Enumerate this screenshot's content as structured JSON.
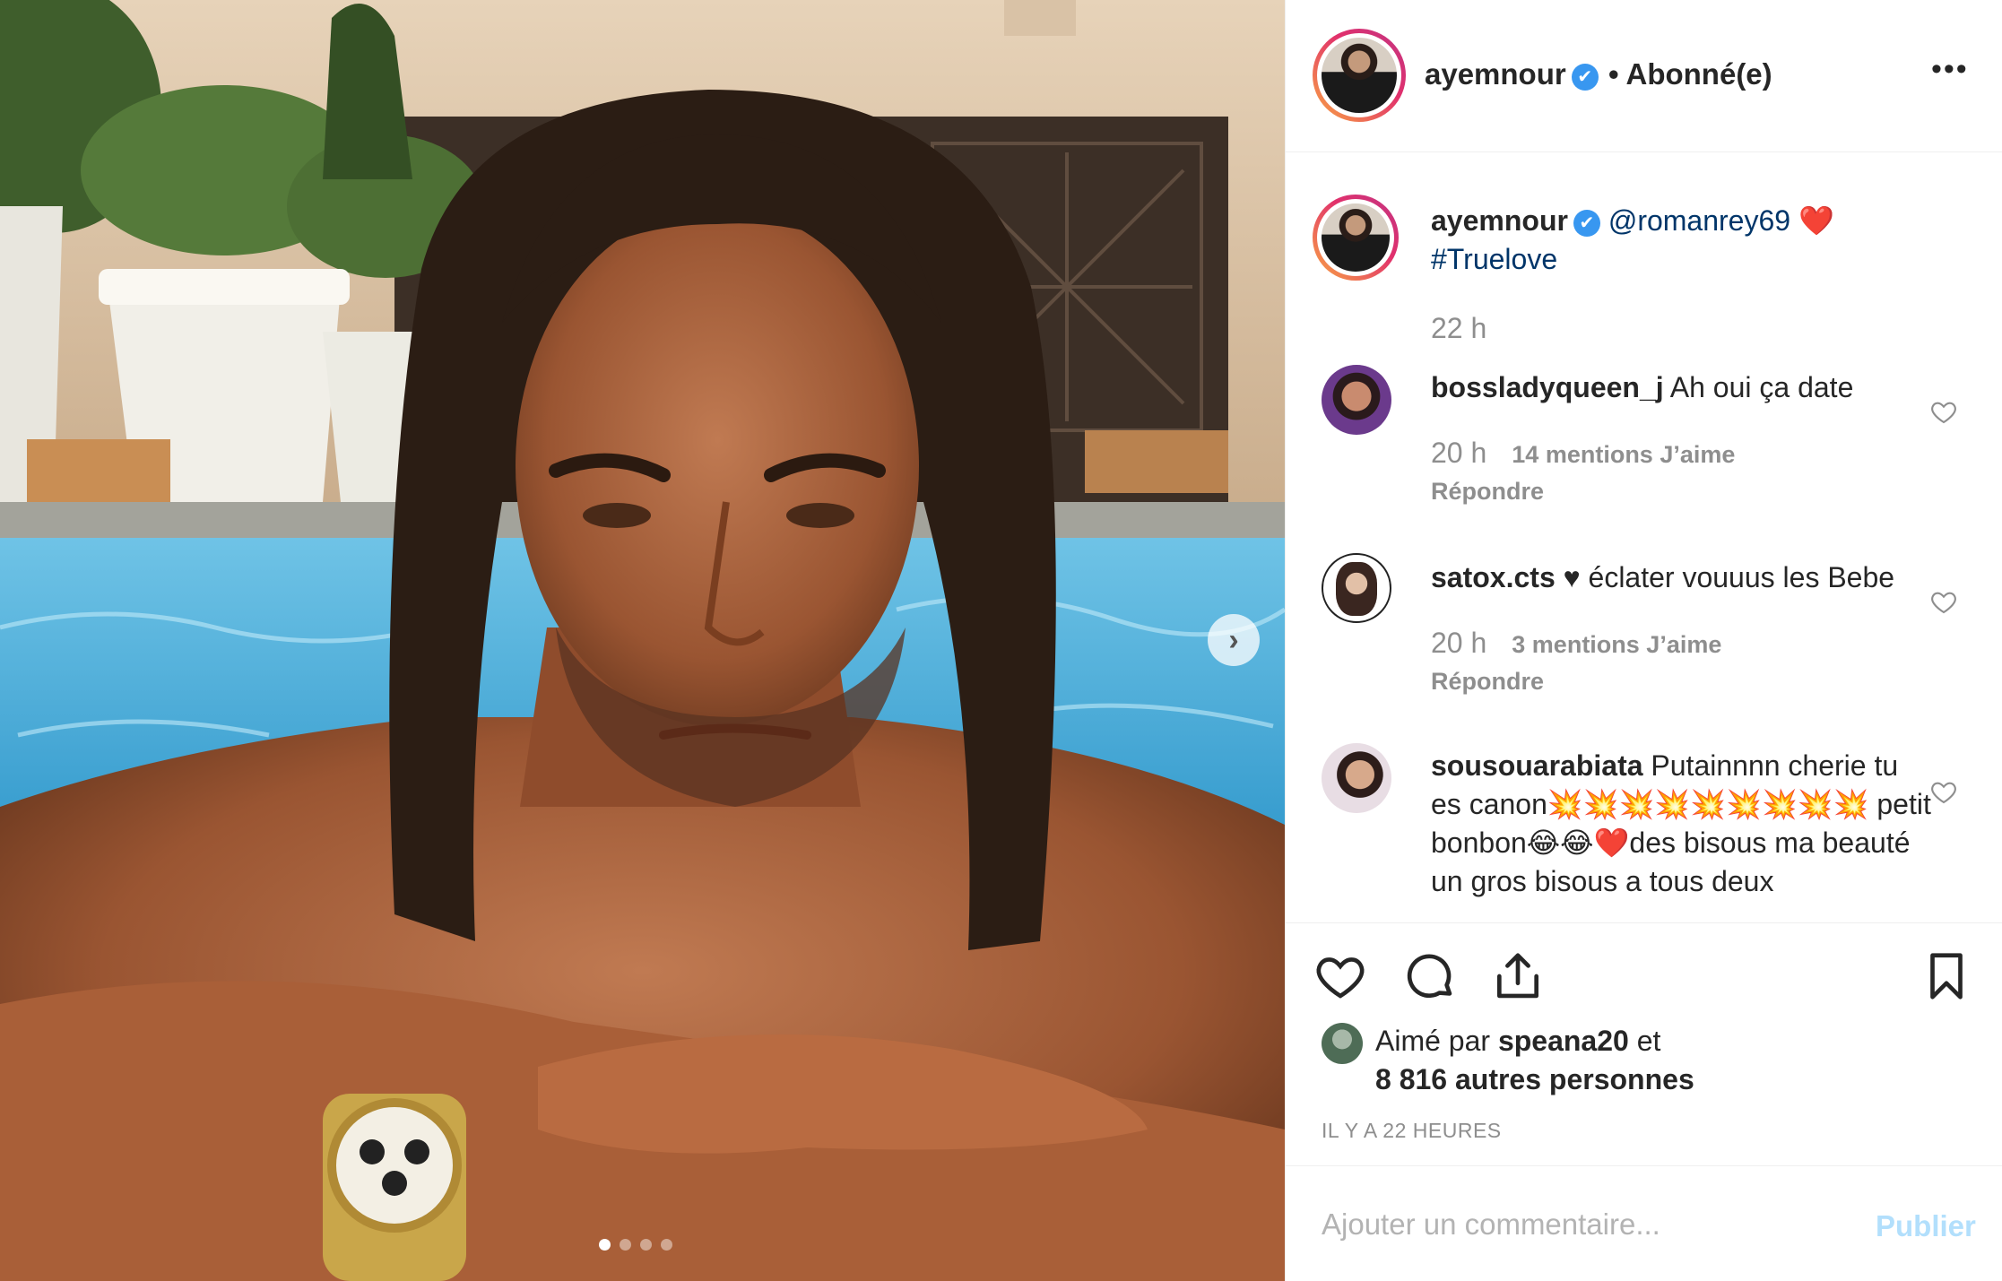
{
  "post": {
    "carousel": {
      "total_slides": 4,
      "active_slide": 1
    },
    "icons": {
      "next": "chevron-right-icon"
    }
  },
  "header": {
    "username": "ayemnour",
    "verified_icon": "✔",
    "follow_status": "• Abonné(e)",
    "more_icon": "•••"
  },
  "caption": {
    "username": "ayemnour",
    "mention": "@romanrey69",
    "emoji": "❤️",
    "hashtag": "#Truelove",
    "time": "22 h"
  },
  "comments": [
    {
      "username": "bossladyqueen_j",
      "text": "Ah oui ça date",
      "time": "20 h",
      "likes": "14 mentions J’aime",
      "reply": "Répondre"
    },
    {
      "username": "satox.cts",
      "text": "♥︎ éclater vouuus les Bebe",
      "time": "20 h",
      "likes": "3 mentions J’aime",
      "reply": "Répondre"
    },
    {
      "username": "sousouarabiata",
      "text": "Putainnnn cherie tu es canon💥💥💥💥💥💥💥💥💥 petit bonbon😂😂❤️des bisous ma beauté un gros bisous a tous deux"
    }
  ],
  "actions": {
    "liked_by_prefix": "Aimé par",
    "liked_by_user": "speana20",
    "liked_by_and": "et",
    "liked_by_count": "8 816 autres personnes",
    "time_ago": "IL Y A 22 HEURES"
  },
  "comment_box": {
    "placeholder": "Ajouter un commentaire...",
    "publish_label": "Publier"
  },
  "colors": {
    "link": "#003569",
    "verified": "#3897f0",
    "muted": "#8e8e8e",
    "publish_disabled": "#b2dffc"
  }
}
